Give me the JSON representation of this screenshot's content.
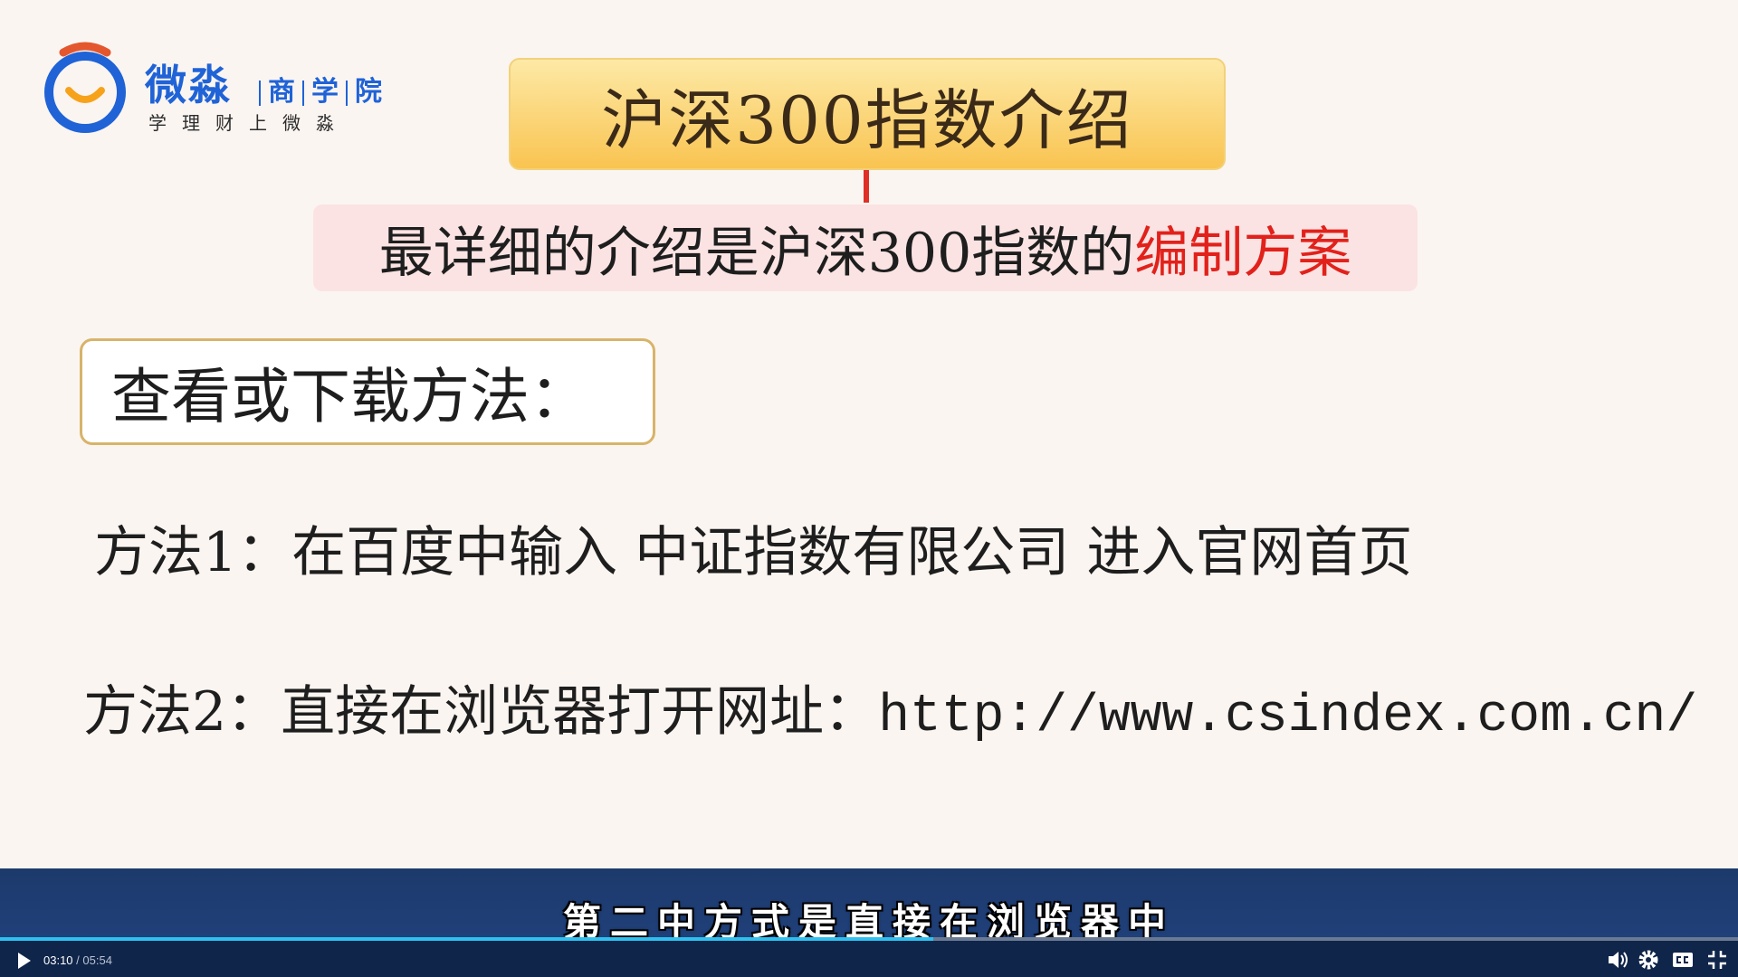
{
  "logo": {
    "brand_main": "微淼",
    "brand_sub_1": "商",
    "brand_sub_2": "学",
    "brand_sub_3": "院",
    "tagline": "学理财上微淼",
    "colors": {
      "ring": "#1f63d7",
      "smile": "#f7a21b",
      "accent": "#e4572e"
    }
  },
  "slide": {
    "title": "沪深300指数介绍",
    "subtitle_prefix": "最详细的介绍是沪深300指数的",
    "subtitle_highlight": "编制方案",
    "method_heading": "查看或下载方法：",
    "method1": "方法1：在百度中输入  中证指数有限公司  进入官网首页",
    "method2_prefix": "方法2：直接在浏览器打开网址：",
    "method2_url": "http://www.csindex.com.cn/",
    "colors": {
      "highlight": "#e2211b",
      "title_bg": "#f9c451",
      "subtitle_bg": "#fbe3e3"
    }
  },
  "caption": {
    "text": "第二中方式是直接在浏览器中"
  },
  "player": {
    "current_time": "03:10",
    "separator": " / ",
    "duration": "05:54",
    "progress_fraction": 0.537,
    "icons": [
      "play-icon",
      "volume-icon",
      "gear-icon",
      "closed-captions-icon",
      "exit-fullscreen-icon"
    ],
    "colors": {
      "bar_bg": "#10254a",
      "progress": "#2ec1f0"
    }
  }
}
